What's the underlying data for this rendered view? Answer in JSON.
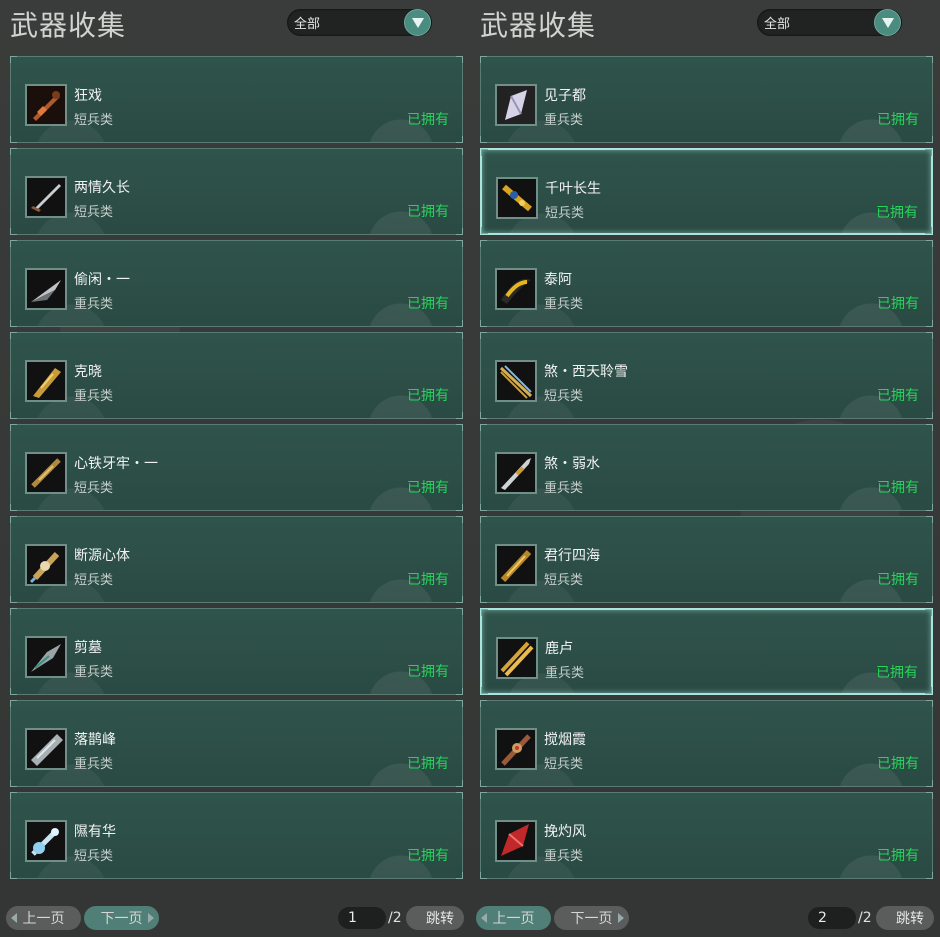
{
  "left": {
    "title": "武器收集",
    "filter": "全部",
    "items": [
      {
        "name": "狂戏",
        "type": "短兵类",
        "status": "已拥有"
      },
      {
        "name": "两情久长",
        "type": "短兵类",
        "status": "已拥有"
      },
      {
        "name": "偷闲・一",
        "type": "重兵类",
        "status": "已拥有"
      },
      {
        "name": "克晓",
        "type": "重兵类",
        "status": "已拥有"
      },
      {
        "name": "心铁牙牢・一",
        "type": "短兵类",
        "status": "已拥有"
      },
      {
        "name": "断源心体",
        "type": "短兵类",
        "status": "已拥有"
      },
      {
        "name": "剪墓",
        "type": "重兵类",
        "status": "已拥有"
      },
      {
        "name": "落鹊峰",
        "type": "重兵类",
        "status": "已拥有"
      },
      {
        "name": "隰有华",
        "type": "短兵类",
        "status": "已拥有"
      }
    ],
    "pager": {
      "prev": "上一页",
      "next": "下一页",
      "page": "1",
      "total": "/2",
      "jump": "跳转"
    }
  },
  "right": {
    "title": "武器收集",
    "filter": "全部",
    "items": [
      {
        "name": "见子都",
        "type": "重兵类",
        "status": "已拥有"
      },
      {
        "name": "千叶长生",
        "type": "短兵类",
        "status": "已拥有"
      },
      {
        "name": "泰阿",
        "type": "重兵类",
        "status": "已拥有"
      },
      {
        "name": "煞・西天聆雪",
        "type": "短兵类",
        "status": "已拥有"
      },
      {
        "name": "煞・弱水",
        "type": "重兵类",
        "status": "已拥有"
      },
      {
        "name": "君行四海",
        "type": "短兵类",
        "status": "已拥有"
      },
      {
        "name": "鹿卢",
        "type": "重兵类",
        "status": "已拥有"
      },
      {
        "name": "搅烟霞",
        "type": "短兵类",
        "status": "已拥有"
      },
      {
        "name": "挽灼风",
        "type": "重兵类",
        "status": "已拥有"
      }
    ],
    "pager": {
      "prev": "上一页",
      "next": "下一页",
      "page": "2",
      "total": "/2",
      "jump": "跳转"
    }
  },
  "colors": {
    "owned": "#27d45a",
    "card_bg": "#2e5048",
    "accent": "#4f7f76"
  }
}
